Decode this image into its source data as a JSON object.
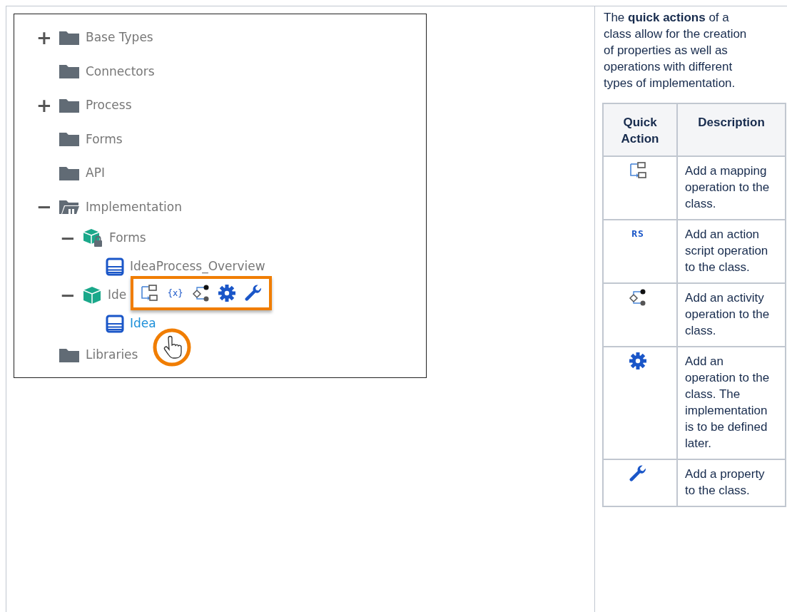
{
  "screenshot": {
    "tree": [
      {
        "toggle": "+",
        "kind": "folder",
        "label": "Base Types"
      },
      {
        "kind": "folder",
        "label": "Connectors"
      },
      {
        "toggle": "+",
        "kind": "folder",
        "label": "Process"
      },
      {
        "kind": "folder",
        "label": "Forms"
      },
      {
        "kind": "folder",
        "label": "API"
      },
      {
        "toggle": "−",
        "kind": "openfolder",
        "label": "Implementation",
        "children": [
          {
            "toggle": "−",
            "kind": "lockedpackage",
            "label": "Forms",
            "children": [
              {
                "kind": "form",
                "label": "IdeaProcess_Overview"
              }
            ]
          },
          {
            "toggle": "−",
            "kind": "package",
            "label": "Ide",
            "children": [
              {
                "kind": "formlink",
                "label": "Idea"
              }
            ]
          }
        ]
      },
      {
        "kind": "folder",
        "label": "Libraries"
      }
    ],
    "quick_action_bar": [
      {
        "kind": "mapping"
      },
      {
        "kind": "script",
        "glyph": "{x}"
      },
      {
        "kind": "activity"
      },
      {
        "kind": "gear"
      },
      {
        "kind": "wrench"
      }
    ]
  },
  "intro": "The **quick actions** of a class allow for the creation of properties as well as operations with different types of implementation.",
  "table": {
    "columns": [
      "Quick Action",
      "Description"
    ],
    "rows": [
      {
        "kind": "mapping",
        "description": "Add a mapping operation to the class."
      },
      {
        "kind": "script",
        "glyph": "RS",
        "description": "Add an action script operation to the class."
      },
      {
        "kind": "activity",
        "description": "Add an activity operation to the class."
      },
      {
        "kind": "gear",
        "description": "Add an operation to the class. The implementation is to be defined later."
      },
      {
        "kind": "wrench",
        "description": "Add a property to the class."
      }
    ]
  }
}
